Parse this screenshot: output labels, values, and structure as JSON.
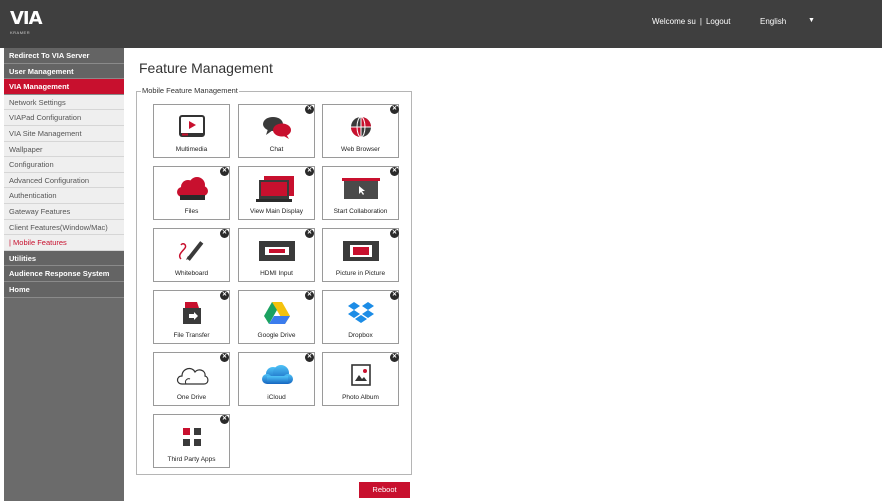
{
  "header": {
    "logo_text": "VIA",
    "logo_sub": "KRAMER",
    "welcome": "Welcome su",
    "separator": "|",
    "logout": "Logout",
    "language": "English",
    "caret": "▼"
  },
  "sidebar": {
    "items": [
      {
        "label": "Redirect To VIA Server",
        "style": "dark"
      },
      {
        "label": "User Management",
        "style": "dark"
      },
      {
        "label": "VIA Management",
        "style": "active"
      },
      {
        "label": "Network Settings",
        "style": "sub"
      },
      {
        "label": "VIAPad Configuration",
        "style": "sub"
      },
      {
        "label": "VIA Site Management",
        "style": "sub"
      },
      {
        "label": "Wallpaper",
        "style": "sub"
      },
      {
        "label": "Configuration",
        "style": "sub"
      },
      {
        "label": "Advanced Configuration",
        "style": "sub"
      },
      {
        "label": "Authentication",
        "style": "sub"
      },
      {
        "label": "Gateway Features",
        "style": "sub"
      },
      {
        "label": "Client Features(Window/Mac)",
        "style": "sub"
      },
      {
        "label": "| Mobile Features",
        "style": "sub-active"
      },
      {
        "label": "Utilities",
        "style": "dark"
      },
      {
        "label": "Audience Response System",
        "style": "dark"
      },
      {
        "label": "Home",
        "style": "dark"
      }
    ]
  },
  "main": {
    "title": "Feature Management",
    "legend": "Mobile Feature Management",
    "close_glyph": "✕",
    "features": [
      {
        "label": "Multimedia",
        "icon": "multimedia-icon",
        "closable": false
      },
      {
        "label": "Chat",
        "icon": "chat-icon",
        "closable": true
      },
      {
        "label": "Web Browser",
        "icon": "web-browser-icon",
        "closable": true
      },
      {
        "label": "Files",
        "icon": "files-cloud-icon",
        "closable": true
      },
      {
        "label": "View Main Display",
        "icon": "view-main-display-icon",
        "closable": true
      },
      {
        "label": "Start Collaboration",
        "icon": "start-collaboration-icon",
        "closable": true
      },
      {
        "label": "Whiteboard",
        "icon": "whiteboard-icon",
        "closable": true
      },
      {
        "label": "HDMI Input",
        "icon": "hdmi-input-icon",
        "closable": true
      },
      {
        "label": "Picture in Picture",
        "icon": "picture-in-picture-icon",
        "closable": true
      },
      {
        "label": "File Transfer",
        "icon": "file-transfer-icon",
        "closable": true
      },
      {
        "label": "Google Drive",
        "icon": "google-drive-icon",
        "closable": true
      },
      {
        "label": "Dropbox",
        "icon": "dropbox-icon",
        "closable": true
      },
      {
        "label": "One Drive",
        "icon": "one-drive-icon",
        "closable": true
      },
      {
        "label": "iCloud",
        "icon": "icloud-icon",
        "closable": true
      },
      {
        "label": "Photo Album",
        "icon": "photo-album-icon",
        "closable": true
      },
      {
        "label": "Third Party Apps",
        "icon": "third-party-apps-icon",
        "closable": true
      }
    ],
    "reboot_label": "Reboot"
  },
  "colors": {
    "accent": "#c8102e",
    "topbar": "#3f3f3f",
    "sidebar": "#6b6b6b"
  }
}
